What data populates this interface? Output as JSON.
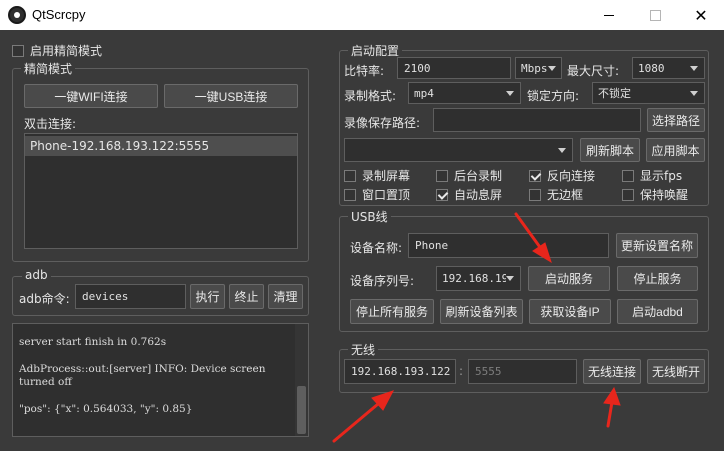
{
  "window": {
    "title": "QtScrcpy"
  },
  "simple_mode": {
    "checkbox_label": "启用精简模式",
    "checked": false
  },
  "simple_group": {
    "title": "精简模式",
    "wifi_button": "一键WIFI连接",
    "usb_button": "一键USB连接",
    "double_click_label": "双击连接:",
    "devices": [
      "Phone-192.168.193.122:5555"
    ]
  },
  "adb_group": {
    "title": "adb",
    "command_label": "adb命令:",
    "command_value": "devices",
    "execute_button": "执行",
    "stop_button": "终止",
    "clear_button": "清理"
  },
  "log": {
    "lines": [
      "server start finish in 0.762s",
      "AdbProcess::out:[server] INFO: Device screen turned off",
      "\"pos\": {\"x\": 0.564033, \"y\": 0.85}"
    ]
  },
  "start_config": {
    "title": "启动配置",
    "bitrate_label": "比特率:",
    "bitrate_value": "2100",
    "bitrate_unit": "Mbps",
    "max_size_label": "最大尺寸:",
    "max_size_value": "1080",
    "record_format_label": "录制格式:",
    "record_format_value": "mp4",
    "lock_orientation_label": "锁定方向:",
    "lock_orientation_value": "不锁定",
    "record_path_label": "录像保存路径:",
    "record_path_value": "",
    "select_path_button": "选择路径",
    "script_value": "",
    "refresh_script_button": "刷新脚本",
    "apply_script_button": "应用脚本",
    "options": [
      {
        "label": "录制屏幕",
        "checked": false
      },
      {
        "label": "后台录制",
        "checked": false
      },
      {
        "label": "反向连接",
        "checked": true
      },
      {
        "label": "显示fps",
        "checked": false
      },
      {
        "label": "窗口置顶",
        "checked": false
      },
      {
        "label": "自动息屏",
        "checked": true
      },
      {
        "label": "无边框",
        "checked": false
      },
      {
        "label": "保持唤醒",
        "checked": false
      }
    ]
  },
  "usb_group": {
    "title": "USB线",
    "device_name_label": "设备名称:",
    "device_name_value": "Phone",
    "update_name_button": "更新设置名称",
    "serial_label": "设备序列号:",
    "serial_value": "192.168.19",
    "start_service_button": "启动服务",
    "stop_service_button": "停止服务",
    "stop_all_button": "停止所有服务",
    "refresh_devices_button": "刷新设备列表",
    "get_ip_button": "获取设备IP",
    "start_adbd_button": "启动adbd"
  },
  "wireless_group": {
    "title": "无线",
    "ip_value": "192.168.193.122",
    "separator": ":",
    "port_placeholder": "5555",
    "connect_button": "无线连接",
    "disconnect_button": "无线断开"
  },
  "annotation_color": "#e8261c"
}
